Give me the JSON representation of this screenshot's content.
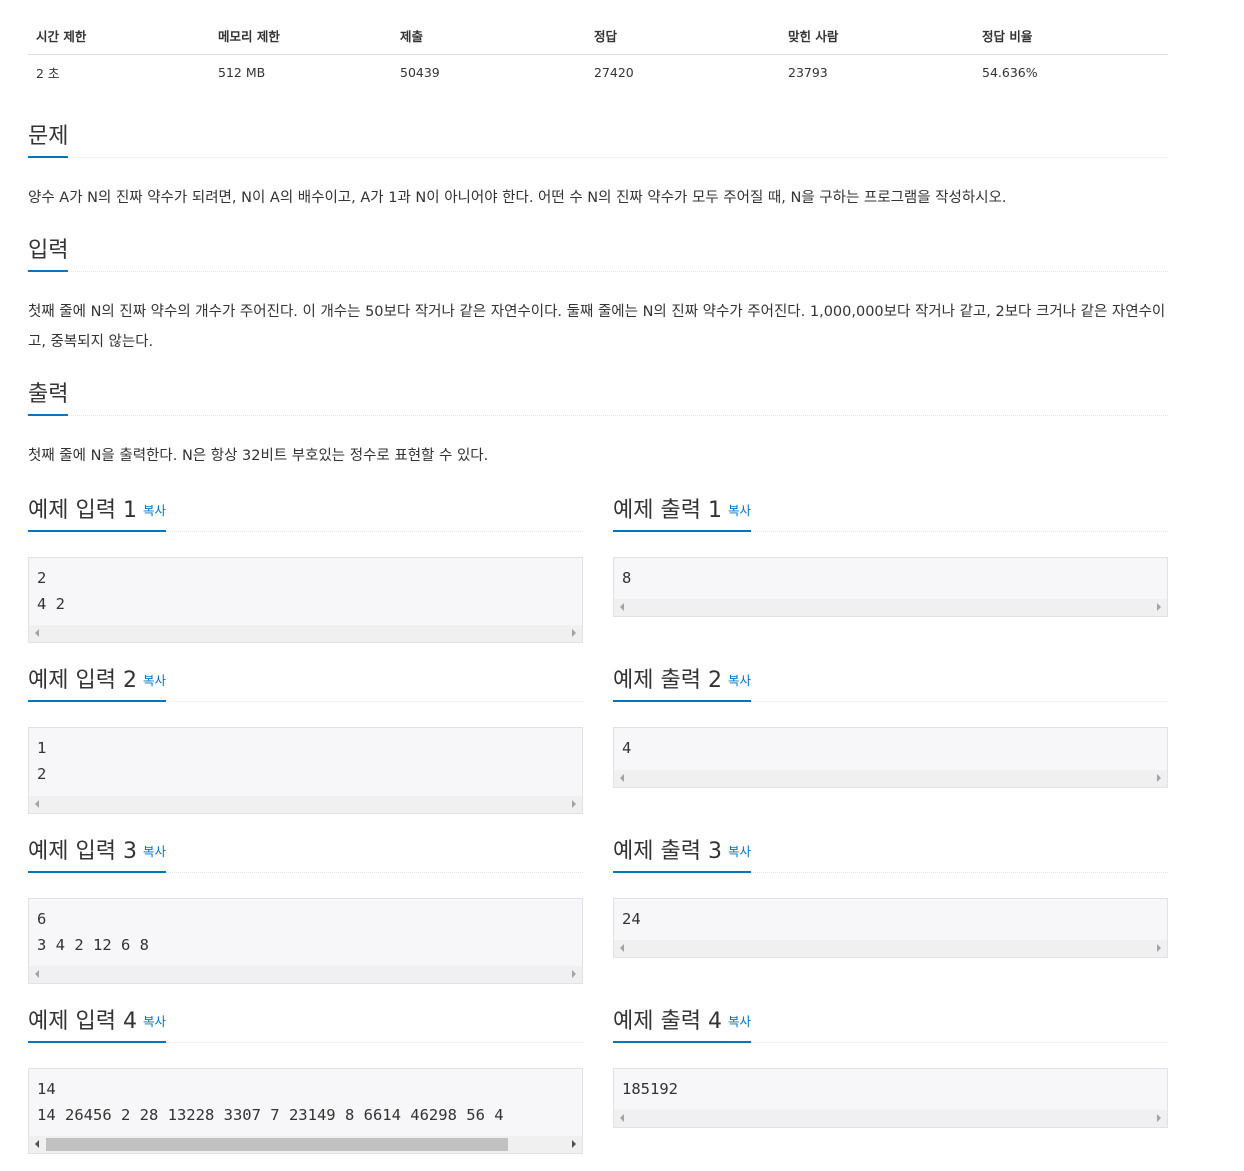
{
  "info": {
    "headers": [
      "시간 제한",
      "메모리 제한",
      "제출",
      "정답",
      "맞힌 사람",
      "정답 비율"
    ],
    "values": [
      "2 초",
      "512 MB",
      "50439",
      "27420",
      "23793",
      "54.636%"
    ]
  },
  "problem": {
    "title": "문제",
    "text": "양수 A가 N의 진짜 약수가 되려면, N이 A의 배수이고, A가 1과 N이 아니어야 한다. 어떤 수 N의 진짜 약수가 모두 주어질 때, N을 구하는 프로그램을 작성하시오."
  },
  "input": {
    "title": "입력",
    "text": "첫째 줄에 N의 진짜 약수의 개수가 주어진다. 이 개수는 50보다 작거나 같은 자연수이다. 둘째 줄에는 N의 진짜 약수가 주어진다. 1,000,000보다 작거나 같고, 2보다 크거나 같은 자연수이고, 중복되지 않는다."
  },
  "output": {
    "title": "출력",
    "text": "첫째 줄에 N을 출력한다. N은 항상 32비트 부호있는 정수로 표현할 수 있다."
  },
  "copy_label": "복사",
  "samples": [
    {
      "input_title": "예제 입력 1",
      "output_title": "예제 출력 1",
      "input": "2\n4 2",
      "output": "8"
    },
    {
      "input_title": "예제 입력 2",
      "output_title": "예제 출력 2",
      "input": "1\n2",
      "output": "4"
    },
    {
      "input_title": "예제 입력 3",
      "output_title": "예제 출력 3",
      "input": "6\n3 4 2 12 6 8",
      "output": "24"
    },
    {
      "input_title": "예제 입력 4",
      "output_title": "예제 출력 4",
      "input": "14\n14 26456 2 28 13228 3307 7 23149 8 6614 46298 56 4",
      "output": "185192"
    }
  ]
}
